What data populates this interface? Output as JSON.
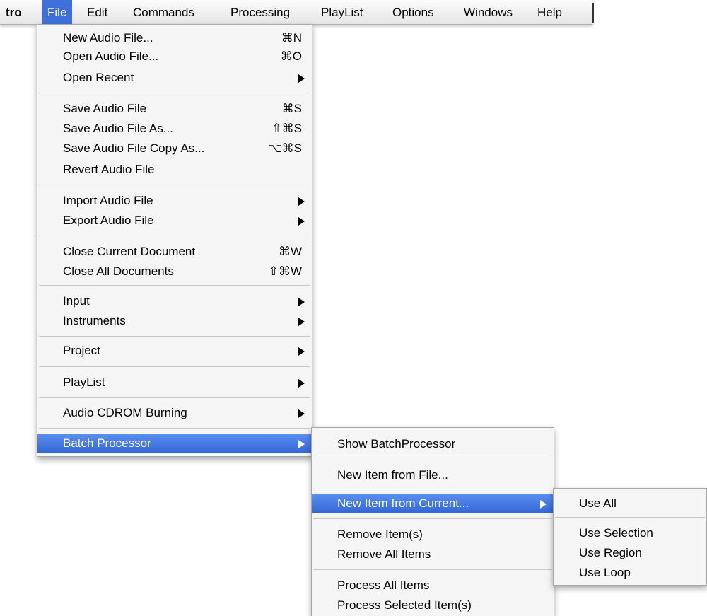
{
  "menubar": {
    "app_label": "tro",
    "items": [
      "File",
      "Edit",
      "Commands",
      "Processing",
      "PlayList",
      "Options",
      "Windows",
      "Help"
    ]
  },
  "file_menu": {
    "items": [
      {
        "label": "New Audio File...",
        "shortcut": "⌘N"
      },
      {
        "label": "Open Audio File...",
        "shortcut": "⌘O"
      },
      {
        "label": "Open Recent",
        "submenu": true
      },
      {
        "label": "Save Audio File",
        "shortcut": "⌘S"
      },
      {
        "label": "Save Audio File As...",
        "shortcut": "⇧⌘S"
      },
      {
        "label": "Save Audio File Copy As...",
        "shortcut": "⌥⌘S"
      },
      {
        "label": "Revert Audio File"
      },
      {
        "label": "Import Audio File",
        "submenu": true
      },
      {
        "label": "Export Audio File",
        "submenu": true
      },
      {
        "label": "Close Current Document",
        "shortcut": "⌘W"
      },
      {
        "label": "Close All Documents",
        "shortcut": "⇧⌘W"
      },
      {
        "label": "Input",
        "submenu": true
      },
      {
        "label": "Instruments",
        "submenu": true
      },
      {
        "label": "Project",
        "submenu": true
      },
      {
        "label": "PlayList",
        "submenu": true
      },
      {
        "label": "Audio CDROM Burning",
        "submenu": true
      },
      {
        "label": "Batch Processor",
        "submenu": true,
        "highlighted": true
      }
    ]
  },
  "batch_menu": {
    "items": [
      {
        "label": "Show BatchProcessor"
      },
      {
        "label": "New Item from File..."
      },
      {
        "label": "New Item from Current...",
        "submenu": true,
        "highlighted": true
      },
      {
        "label": "Remove Item(s)"
      },
      {
        "label": "Remove All Items"
      },
      {
        "label": "Process All Items"
      },
      {
        "label": "Process Selected Item(s)"
      }
    ]
  },
  "current_menu": {
    "items": [
      {
        "label": "Use All"
      },
      {
        "label": "Use Selection"
      },
      {
        "label": "Use Region"
      },
      {
        "label": "Use Loop"
      }
    ]
  },
  "colors": {
    "highlight": "#3f6fd8",
    "menu_background": "#f5f5f5"
  }
}
